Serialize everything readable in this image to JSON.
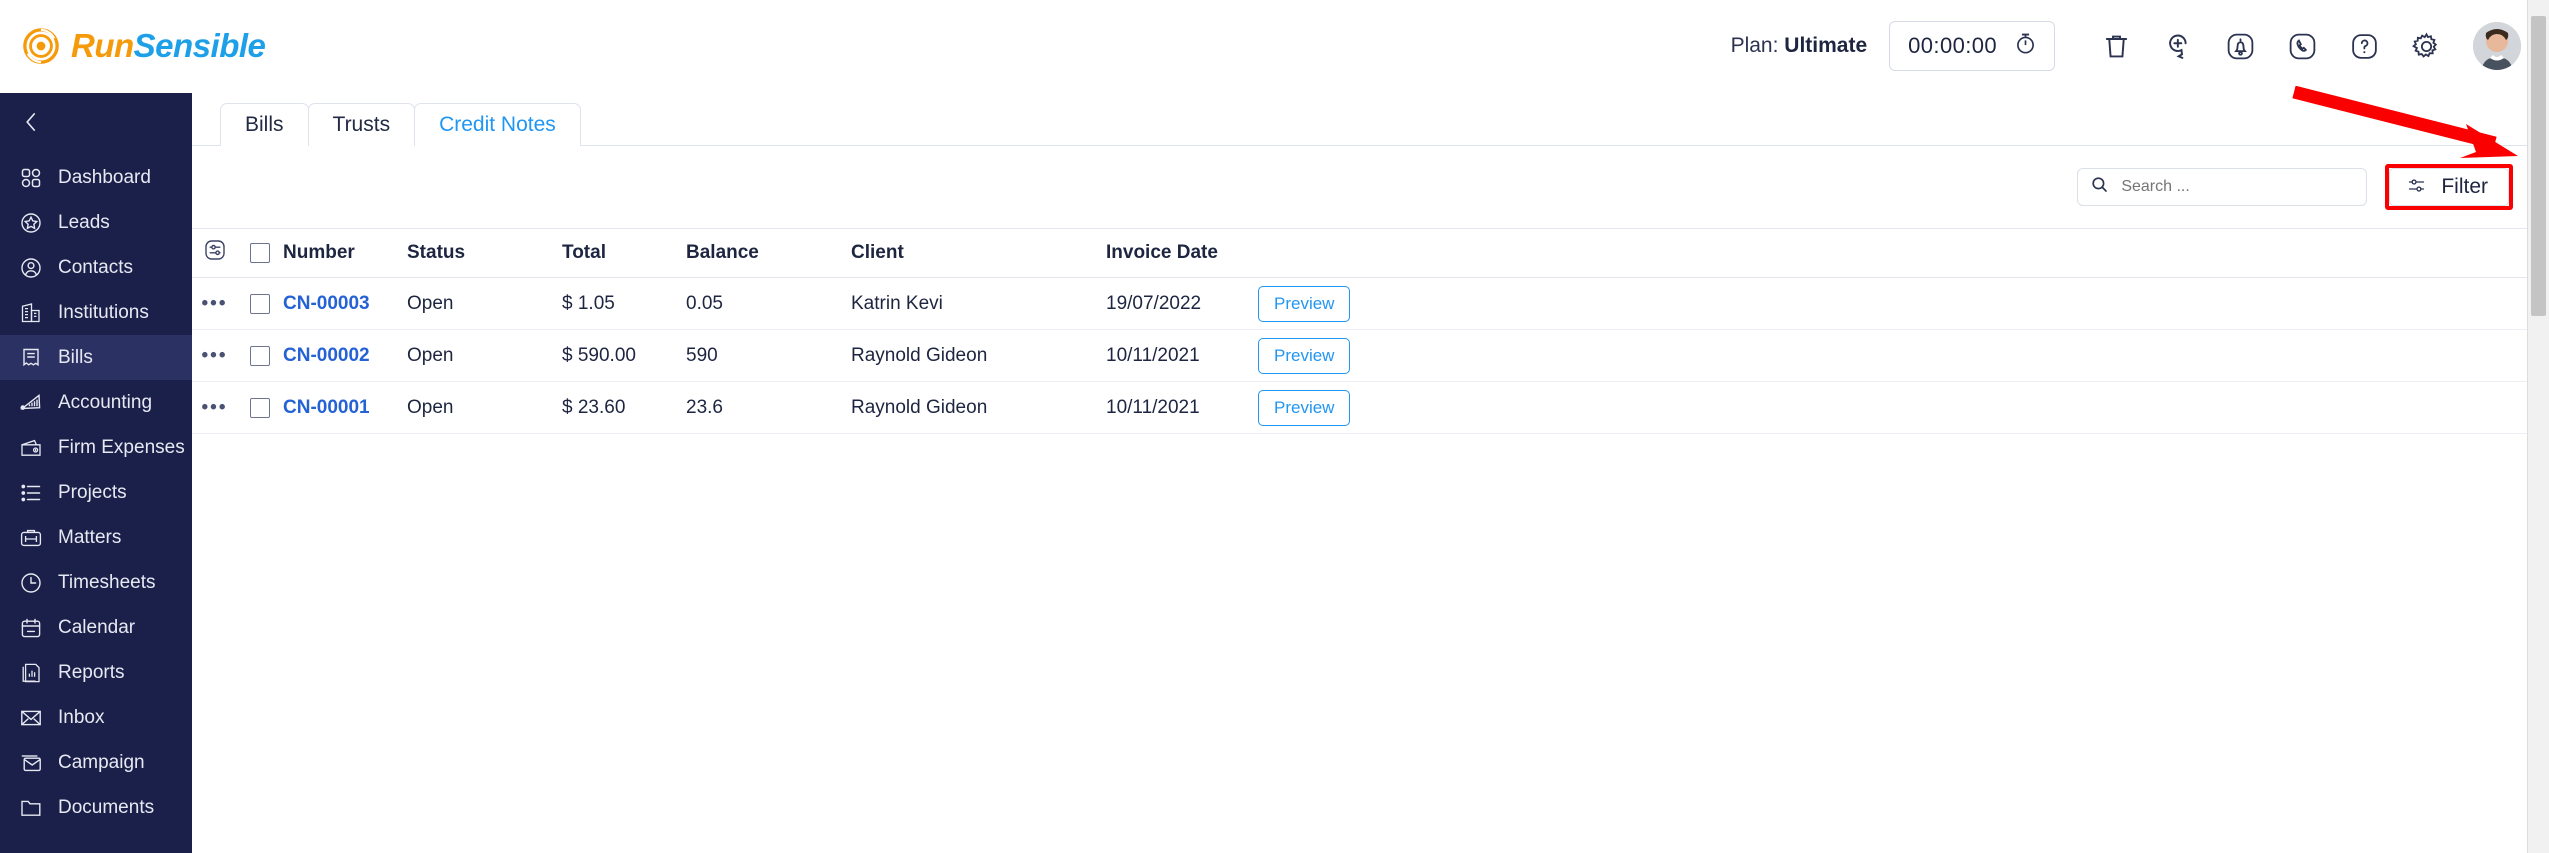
{
  "brand": {
    "name_part1": "Run",
    "name_part2": "Sensible",
    "color_orange": "#F59B0B",
    "color_blue": "#1EA0E8"
  },
  "header": {
    "plan_prefix": "Plan:",
    "plan_value": "Ultimate",
    "timer_value": "00:00:00",
    "icons": [
      {
        "name": "stopwatch-icon"
      },
      {
        "name": "trash-icon"
      },
      {
        "name": "add-task-icon"
      },
      {
        "name": "notification-bell-icon"
      },
      {
        "name": "phone-icon"
      },
      {
        "name": "help-icon"
      },
      {
        "name": "settings-gear-icon"
      },
      {
        "name": "user-avatar"
      }
    ]
  },
  "sidebar": {
    "collapse_icon": "chevron-left-icon",
    "items": [
      {
        "label": "Dashboard",
        "icon": "dashboard-icon",
        "active": false
      },
      {
        "label": "Leads",
        "icon": "leads-icon",
        "active": false
      },
      {
        "label": "Contacts",
        "icon": "contacts-icon",
        "active": false
      },
      {
        "label": "Institutions",
        "icon": "institutions-icon",
        "active": false
      },
      {
        "label": "Bills",
        "icon": "bills-icon",
        "active": true
      },
      {
        "label": "Accounting",
        "icon": "accounting-icon",
        "active": false
      },
      {
        "label": "Firm Expenses",
        "icon": "firm-expenses-icon",
        "active": false
      },
      {
        "label": "Projects",
        "icon": "projects-icon",
        "active": false
      },
      {
        "label": "Matters",
        "icon": "matters-icon",
        "active": false
      },
      {
        "label": "Timesheets",
        "icon": "timesheets-icon",
        "active": false
      },
      {
        "label": "Calendar",
        "icon": "calendar-icon",
        "active": false
      },
      {
        "label": "Reports",
        "icon": "reports-icon",
        "active": false
      },
      {
        "label": "Inbox",
        "icon": "inbox-icon",
        "active": false
      },
      {
        "label": "Campaign",
        "icon": "campaign-icon",
        "active": false
      },
      {
        "label": "Documents",
        "icon": "documents-icon",
        "active": false
      }
    ]
  },
  "tabs": [
    {
      "label": "Bills",
      "active": false
    },
    {
      "label": "Trusts",
      "active": false
    },
    {
      "label": "Credit Notes",
      "active": true
    }
  ],
  "toolbar": {
    "search_placeholder": "Search ...",
    "search_value": "",
    "search_icon": "search-icon",
    "filter_label": "Filter",
    "filter_icon": "filter-sliders-icon",
    "filter_highlight_color": "#fb0000"
  },
  "annotation": {
    "type": "arrow",
    "color": "#fb0000",
    "points_to": "filter-button"
  },
  "table": {
    "columns": [
      "Number",
      "Status",
      "Total",
      "Balance",
      "Client",
      "Invoice Date"
    ],
    "settings_icon": "column-settings-icon",
    "select_all_checked": false,
    "rows": [
      {
        "number": "CN-00003",
        "status": "Open",
        "total": "$ 1.05",
        "balance": "0.05",
        "client": "Katrin Kevi",
        "invoice_date": "19/07/2022",
        "action_label": "Preview",
        "checked": false
      },
      {
        "number": "CN-00002",
        "status": "Open",
        "total": "$ 590.00",
        "balance": "590",
        "client": "Raynold Gideon",
        "invoice_date": "10/11/2021",
        "action_label": "Preview",
        "checked": false
      },
      {
        "number": "CN-00001",
        "status": "Open",
        "total": "$ 23.60",
        "balance": "23.6",
        "client": "Raynold Gideon",
        "invoice_date": "10/11/2021",
        "action_label": "Preview",
        "checked": false
      }
    ]
  }
}
